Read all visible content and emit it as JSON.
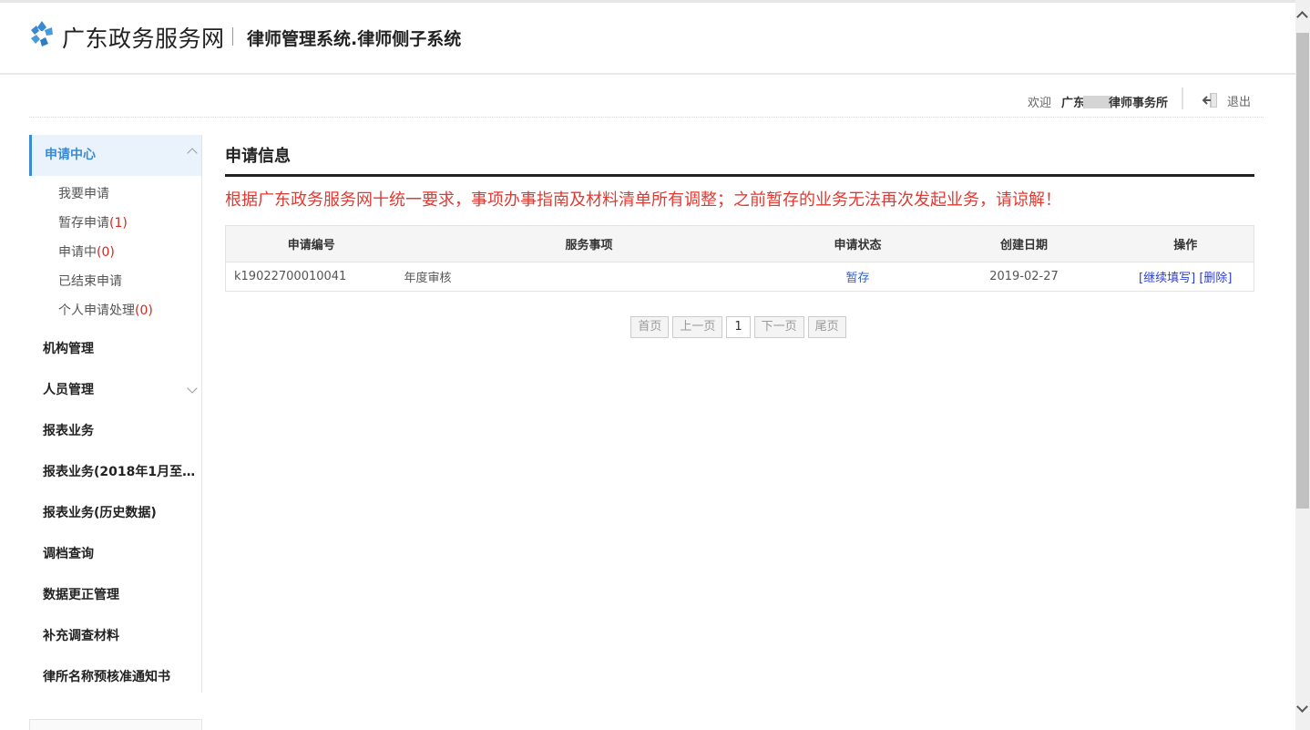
{
  "header": {
    "site_name": "广东政务服务网",
    "system_name": "律师管理系统.律师侧子系统"
  },
  "userbar": {
    "welcome": "欢迎",
    "firm_prefix": "广东",
    "firm_suffix": "律师事务所",
    "logout": "退出"
  },
  "sidebar": {
    "active_group": {
      "label": "申请中心",
      "items": [
        {
          "label": "我要申请",
          "count": ""
        },
        {
          "label": "暂存申请",
          "count": "(1)"
        },
        {
          "label": "申请中",
          "count": "(0)"
        },
        {
          "label": "已结束申请",
          "count": ""
        },
        {
          "label": "个人申请处理",
          "count": "(0)"
        }
      ]
    },
    "items": [
      "机构管理",
      "人员管理",
      "报表业务",
      "报表业务(2018年1月至…",
      "报表业务(历史数据)",
      "调档查询",
      "数据更正管理",
      "补充调查材料",
      "律所名称预核准通知书"
    ]
  },
  "main": {
    "title": "申请信息",
    "notice": "根据广东政务服务网十统一要求，事项办事指南及材料清单所有调整；之前暂存的业务无法再次发起业务，请谅解！",
    "table": {
      "headers": [
        "申请编号",
        "服务事项",
        "申请状态",
        "创建日期",
        "操作"
      ],
      "rows": [
        {
          "no": "k19022700010041",
          "service": "年度审核",
          "status": "暂存",
          "date": "2019-02-27",
          "op_continue": "[继续填写]",
          "op_delete": "[删除]"
        }
      ]
    },
    "pagination": {
      "first": "首页",
      "prev": "上一页",
      "current": "1",
      "next": "下一页",
      "last": "尾页"
    }
  },
  "colors": {
    "accent": "#3b8bd4",
    "notice_red": "#e03a32",
    "link_blue": "#2b3fd1"
  }
}
